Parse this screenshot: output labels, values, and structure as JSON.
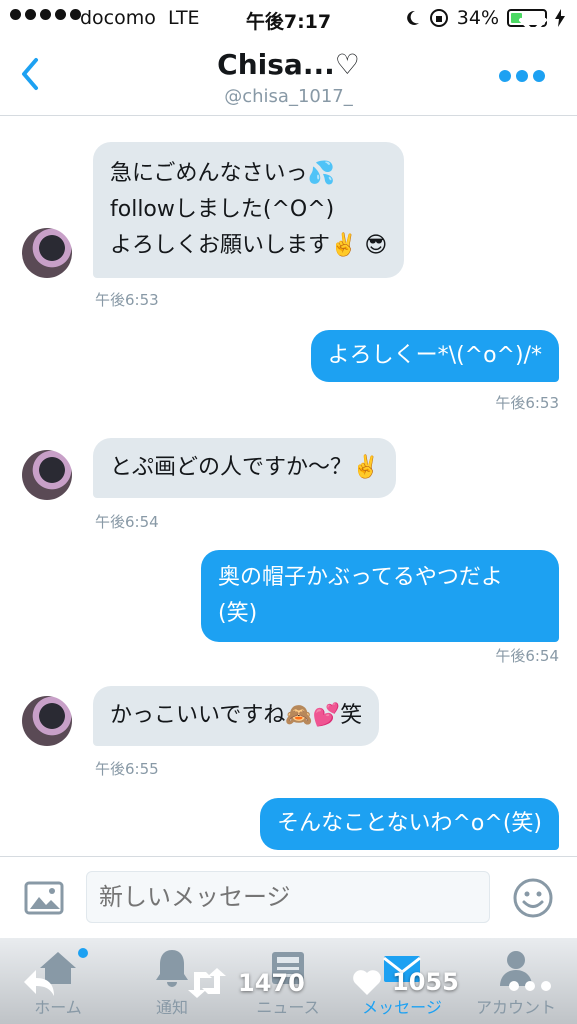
{
  "status_bar": {
    "carrier": "docomo",
    "network": "LTE",
    "time": "午後7:17",
    "battery": "34%",
    "battery_level": 0.34
  },
  "header": {
    "title": "Chisa...♡",
    "handle": "@chisa_1017_"
  },
  "messages": [
    {
      "direction": "incoming",
      "lines": [
        "急にごめんなさいっ💦",
        "followしました(^O^)",
        "よろしくお願いします✌️ 😎"
      ],
      "time": "午後6:53"
    },
    {
      "direction": "outgoing",
      "lines": [
        "よろしくー*\\(^o^)/*"
      ],
      "time": "午後6:53"
    },
    {
      "direction": "incoming",
      "lines": [
        "とぷ画どの人ですか〜？✌️"
      ],
      "time": "午後6:54"
    },
    {
      "direction": "outgoing",
      "lines": [
        "奥の帽子かぶってるやつだよ",
        "(笑)"
      ],
      "time": "午後6:54"
    },
    {
      "direction": "incoming",
      "lines": [
        "かっこいいですね🙈💕笑"
      ],
      "time": "午後6:55"
    },
    {
      "direction": "outgoing",
      "lines": [
        "そんなことないわ^o^(笑)"
      ],
      "time": ""
    }
  ],
  "compose": {
    "placeholder": "新しいメッセージ"
  },
  "tabs": [
    {
      "label": "ホーム",
      "icon": "home-icon"
    },
    {
      "label": "通知",
      "icon": "bell-icon"
    },
    {
      "label": "ニュース",
      "icon": "news-icon"
    },
    {
      "label": "メッセージ",
      "icon": "envelope-icon",
      "active": true
    },
    {
      "label": "アカウント",
      "icon": "person-icon"
    }
  ],
  "overlay": {
    "retweets": "1470",
    "likes": "1055"
  },
  "colors": {
    "accent": "#1da1f2",
    "incoming_bubble": "#e1e8ed",
    "timestamp": "#8899a6"
  }
}
